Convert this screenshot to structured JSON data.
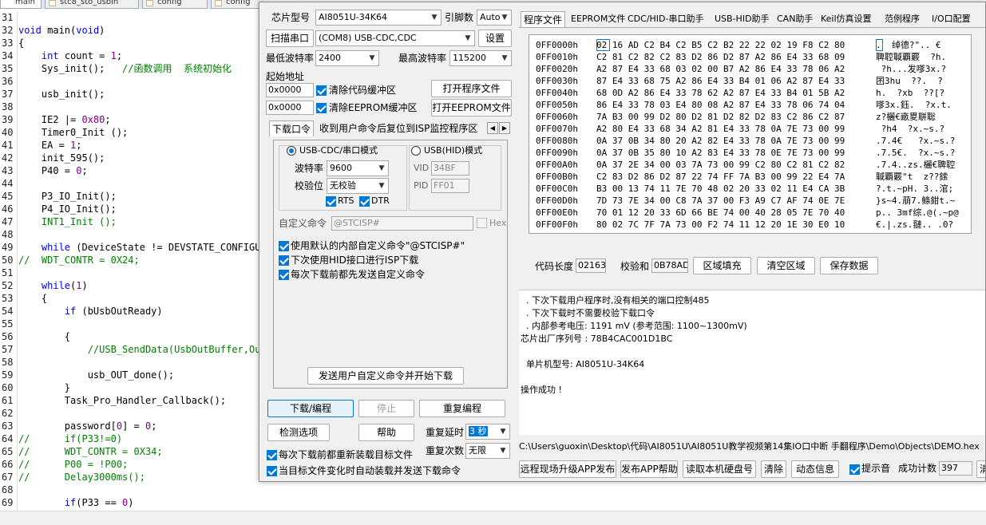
{
  "editor": {
    "tabs": [
      "main",
      "stc8_sto_usbin",
      "config",
      "config"
    ],
    "lines": [
      {
        "num": "31",
        "parts": [
          {
            "t": "",
            "c": ""
          }
        ]
      },
      {
        "num": "32",
        "parts": [
          {
            "t": "void",
            "c": "kw"
          },
          {
            "t": " main(",
            "c": ""
          },
          {
            "t": "void",
            "c": "kw"
          },
          {
            "t": ")",
            "c": ""
          }
        ]
      },
      {
        "num": "33",
        "parts": [
          {
            "t": "{",
            "c": ""
          }
        ]
      },
      {
        "num": "34",
        "parts": [
          {
            "t": "    ",
            "c": ""
          },
          {
            "t": "int",
            "c": "kw"
          },
          {
            "t": " count = ",
            "c": ""
          },
          {
            "t": "1",
            "c": "nm"
          },
          {
            "t": ";",
            "c": ""
          }
        ]
      },
      {
        "num": "35",
        "parts": [
          {
            "t": "    Sys_init();   ",
            "c": ""
          },
          {
            "t": "//函数调用  系统初始化",
            "c": "cm"
          }
        ]
      },
      {
        "num": "36",
        "parts": [
          {
            "t": "",
            "c": ""
          }
        ]
      },
      {
        "num": "37",
        "parts": [
          {
            "t": "    usb_init();",
            "c": ""
          }
        ]
      },
      {
        "num": "38",
        "parts": [
          {
            "t": "",
            "c": ""
          }
        ]
      },
      {
        "num": "39",
        "parts": [
          {
            "t": "    IE2 |= ",
            "c": ""
          },
          {
            "t": "0x80",
            "c": "nm"
          },
          {
            "t": ";",
            "c": ""
          }
        ]
      },
      {
        "num": "40",
        "parts": [
          {
            "t": "    Timer0_Init ();",
            "c": ""
          }
        ]
      },
      {
        "num": "41",
        "parts": [
          {
            "t": "    EA = ",
            "c": ""
          },
          {
            "t": "1",
            "c": "nm"
          },
          {
            "t": ";",
            "c": ""
          }
        ]
      },
      {
        "num": "42",
        "parts": [
          {
            "t": "    init_595();",
            "c": ""
          }
        ]
      },
      {
        "num": "43",
        "parts": [
          {
            "t": "    P40 = ",
            "c": ""
          },
          {
            "t": "0",
            "c": "nm"
          },
          {
            "t": ";",
            "c": ""
          }
        ]
      },
      {
        "num": "44",
        "parts": [
          {
            "t": "",
            "c": ""
          }
        ]
      },
      {
        "num": "45",
        "parts": [
          {
            "t": "    P3_IO_Init();",
            "c": ""
          }
        ]
      },
      {
        "num": "46",
        "parts": [
          {
            "t": "    P4_IO_Init();",
            "c": ""
          }
        ]
      },
      {
        "num": "47",
        "parts": [
          {
            "t": "    INT1_Init ();",
            "c": "cm"
          }
        ]
      },
      {
        "num": "48",
        "parts": [
          {
            "t": "",
            "c": ""
          }
        ]
      },
      {
        "num": "49",
        "parts": [
          {
            "t": "    ",
            "c": ""
          },
          {
            "t": "while",
            "c": "kw"
          },
          {
            "t": " (DeviceState != DEVSTATE_CONFIGURED);",
            "c": ""
          }
        ]
      },
      {
        "num": "50",
        "parts": [
          {
            "t": "//  WDT_CONTR = 0X24;",
            "c": "cm"
          }
        ]
      },
      {
        "num": "51",
        "parts": [
          {
            "t": "",
            "c": ""
          }
        ]
      },
      {
        "num": "52",
        "parts": [
          {
            "t": "    ",
            "c": ""
          },
          {
            "t": "while",
            "c": "kw"
          },
          {
            "t": "(",
            "c": ""
          },
          {
            "t": "1",
            "c": "nm"
          },
          {
            "t": ")",
            "c": ""
          }
        ]
      },
      {
        "num": "53",
        "parts": [
          {
            "t": "    {",
            "c": ""
          }
        ]
      },
      {
        "num": "54",
        "parts": [
          {
            "t": "        ",
            "c": ""
          },
          {
            "t": "if",
            "c": "kw"
          },
          {
            "t": " (bUsbOutReady)",
            "c": ""
          }
        ]
      },
      {
        "num": "55",
        "parts": [
          {
            "t": "",
            "c": ""
          }
        ]
      },
      {
        "num": "56",
        "parts": [
          {
            "t": "        {",
            "c": ""
          }
        ]
      },
      {
        "num": "57",
        "parts": [
          {
            "t": "            ",
            "c": ""
          },
          {
            "t": "//USB_SendData(UsbOutBuffer,OutNumber);",
            "c": "cm"
          }
        ]
      },
      {
        "num": "58",
        "parts": [
          {
            "t": "",
            "c": ""
          }
        ]
      },
      {
        "num": "59",
        "parts": [
          {
            "t": "            usb_OUT_done();",
            "c": ""
          }
        ]
      },
      {
        "num": "60",
        "parts": [
          {
            "t": "        }",
            "c": ""
          }
        ]
      },
      {
        "num": "61",
        "parts": [
          {
            "t": "        Task_Pro_Handler_Callback();",
            "c": ""
          }
        ]
      },
      {
        "num": "62",
        "parts": [
          {
            "t": "",
            "c": ""
          }
        ]
      },
      {
        "num": "63",
        "parts": [
          {
            "t": "        password[",
            "c": ""
          },
          {
            "t": "0",
            "c": "nm"
          },
          {
            "t": "] = ",
            "c": ""
          },
          {
            "t": "0",
            "c": "nm"
          },
          {
            "t": ";",
            "c": ""
          }
        ]
      },
      {
        "num": "64",
        "parts": [
          {
            "t": "//      if(P33!=0)",
            "c": "cm"
          }
        ]
      },
      {
        "num": "65",
        "parts": [
          {
            "t": "//      WDT_CONTR = 0X34;",
            "c": "cm"
          }
        ]
      },
      {
        "num": "66",
        "parts": [
          {
            "t": "//      P00 = !P00;",
            "c": "cm"
          }
        ]
      },
      {
        "num": "67",
        "parts": [
          {
            "t": "//      Delay3000ms();",
            "c": "cm"
          }
        ]
      },
      {
        "num": "68",
        "parts": [
          {
            "t": "",
            "c": ""
          }
        ]
      },
      {
        "num": "69",
        "parts": [
          {
            "t": "        ",
            "c": ""
          },
          {
            "t": "if",
            "c": "kw"
          },
          {
            "t": "(P33 == ",
            "c": ""
          },
          {
            "t": "0",
            "c": "nm"
          },
          {
            "t": ")",
            "c": ""
          }
        ]
      }
    ]
  },
  "isp": {
    "chip_label": "芯片型号",
    "chip_value": "AI8051U-34K64",
    "pin_label": "引脚数",
    "pin_value": "Auto",
    "scan_button": "扫描串口",
    "port_value": "(COM8) USB-CDC,CDC",
    "settings_button": "设置",
    "min_baud_label": "最低波特率",
    "min_baud_value": "2400",
    "max_baud_label": "最高波特率",
    "max_baud_value": "115200",
    "start_addr_label": "起始地址",
    "code_addr": "0x0000",
    "clear_code_label": "清除代码缓冲区",
    "open_program_button": "打开程序文件",
    "eeprom_addr": "0x0000",
    "clear_eeprom_label": "清除EEPROM缓冲区",
    "open_eeprom_button": "打开EEPROM文件",
    "subtabs": [
      "下载口令",
      "收到用户命令后复位到ISP监控程序区"
    ],
    "usb_cdc_mode_label": "USB-CDC/串口模式",
    "usb_hid_mode_label": "USB(HID)模式",
    "baud_label": "波特率",
    "baud_value": "9600",
    "parity_label": "校验位",
    "parity_value": "无校验",
    "rts_label": "RTS",
    "dtr_label": "DTR",
    "vid_label": "VID",
    "vid_value": "34BF",
    "pid_label": "PID",
    "pid_value": "FF01",
    "custom_cmd_label": "自定义命令",
    "custom_cmd_value": "@STCISP#",
    "hex_label": "Hex",
    "opt1": "使用默认的内部自定义命令\"@STCISP#\"",
    "opt2": "下次使用HID接口进行ISP下载",
    "opt3": "每次下载前都先发送自定义命令",
    "send_custom_button": "发送用户自定义命令并开始下载",
    "download_button": "下载/编程",
    "stop_button": "停止",
    "reprogram_button": "重复编程",
    "check_options_button": "检测选项",
    "help_button": "帮助",
    "repeat_delay_label": "重复延时",
    "repeat_delay_value": "3 秒",
    "repeat_count_label": "重复次数",
    "repeat_count_value": "无限",
    "reload_before_label": "每次下载前都重新装载目标文件",
    "auto_reload_label": "当目标文件变化时自动装载并发送下载命令",
    "right_tabs": [
      "程序文件",
      "EEPROM文件",
      "CDC/HID-串口助手",
      "USB-HID助手",
      "CAN助手",
      "Keil仿真设置",
      "范例程序",
      "I/O口配置"
    ],
    "hex_rows": [
      {
        "addr": "0FF0000h",
        "bytes": "02 16 AD C2 B4 C2 B5 C2 B2 22 22 02 19 F8 C2 80",
        "ascii": ".  绰德?\".. €"
      },
      {
        "addr": "0FF0010h",
        "bytes": "C2 81 C2 82 C2 83 D2 86 D2 87 A2 86 E4 33 68 09",
        "ascii": "聛聜聝覇覈  ?h."
      },
      {
        "addr": "0FF0020h",
        "bytes": "A2 87 E4 33 68 03 02 00 B7 A2 86 E4 33 78 06 A2",
        "ascii": " ?h...发嗲3x.?"
      },
      {
        "addr": "0FF0030h",
        "bytes": "87 E4 33 68 75 A2 86 E4 33 B4 01 06 A2 87 E4 33",
        "ascii": "囨3hu  ??.  ?"
      },
      {
        "addr": "0FF0040h",
        "bytes": "68 0D A2 86 E4 33 78 62 A2 87 E4 33 B4 01 5B A2",
        "ascii": "h.  ?xb  ??[?"
      },
      {
        "addr": "0FF0050h",
        "bytes": "86 E4 33 78 03 E4 80 08 A2 87 E4 33 78 06 74 04",
        "ascii": "嗲3x.鈺.  ?x.t."
      },
      {
        "addr": "0FF0060h",
        "bytes": "7A B3 00 99 D2 80 D2 81 D2 82 D2 83 C2 86 C2 87",
        "ascii": "z?欐€畞畟聠聡"
      },
      {
        "addr": "0FF0070h",
        "bytes": "A2 80 E4 33 68 34 A2 81 E4 33 78 0A 7E 73 00 99",
        "ascii": " ?h4  ?x.~s.?"
      },
      {
        "addr": "0FF0080h",
        "bytes": "0A 37 0B 34 80 20 A2 82 E4 33 78 0A 7E 73 00 99",
        "ascii": ".7.4€   ?x.~s.?"
      },
      {
        "addr": "0FF0090h",
        "bytes": "0A 37 0B 35 80 10 A2 83 E4 33 78 0E 7E 73 00 99",
        "ascii": ".7.5€.  ?x.~s.?"
      },
      {
        "addr": "0FF00A0h",
        "bytes": "0A 37 2E 34 00 03 7A 73 00 99 C2 80 C2 81 C2 82",
        "ascii": ".7.4..zs.欐€聛聜"
      },
      {
        "addr": "0FF00B0h",
        "bytes": "C2 83 D2 86 D2 87 22 74 FF 7A B3 00 99 22 E4 7A",
        "ascii": "聝覇覈\"t  z??鎍"
      },
      {
        "addr": "0FF00C0h",
        "bytes": "B3 00 13 74 11 7E 70 48 02 20 33 02 11 E4 CA 3B",
        "ascii": "?.t.~pH. 3..涫;"
      },
      {
        "addr": "0FF00D0h",
        "bytes": "7D 73 7E 34 00 C8 7A 37 00 F3 A9 C7 AF 74 0E 7E",
        "ascii": "}s~4.萠7.鲦鉗t.~"
      },
      {
        "addr": "0FF00E0h",
        "bytes": "70 01 12 20 33 6D 66 BE 74 00 40 28 05 7E 70 40",
        "ascii": "p.. 3mf综.@(.~p@"
      },
      {
        "addr": "0FF00F0h",
        "bytes": "80 02 7C 7F 7A 73 00 F2 74 11 12 20 1E 30 E0 10",
        "ascii": "€.|.zs.翴.. .0?"
      }
    ],
    "code_len_label": "代码长度",
    "code_len_value": "02163",
    "checksum_label": "校验和",
    "checksum_value": "0B78AD",
    "fill_button": "区域填充",
    "clear_area_button": "清空区域",
    "save_data_button": "保存数据",
    "log_lines": [
      "  . 下次下载用户程序时,没有相关的端口控制485",
      "  . 下次下载时不需要校验下载口令",
      "  . 内部参考电压: 1191 mV (参考范围: 1100~1300mV)",
      "芯片出厂序列号 : 78B4CAC001D1BC",
      "",
      "  单片机型号: AI8051U-34K64",
      "",
      "操作成功 !"
    ],
    "file_path": "C:\\Users\\guoxin\\Desktop\\代码\\AI8051U\\AI8051U教学视频第14集IO口中断 手翻程序\\Demo\\Objects\\DEMO.hex",
    "remote_upgrade_button": "远程现场升级APP发布",
    "publish_help_button": "发布APP帮助",
    "read_disk_button": "读取本机硬盘号",
    "clear_button": "清除",
    "dynamic_info_button": "动态信息",
    "beep_label": "提示音",
    "success_count_label": "成功计数",
    "success_count_value": "397",
    "clear2_button": "清"
  }
}
